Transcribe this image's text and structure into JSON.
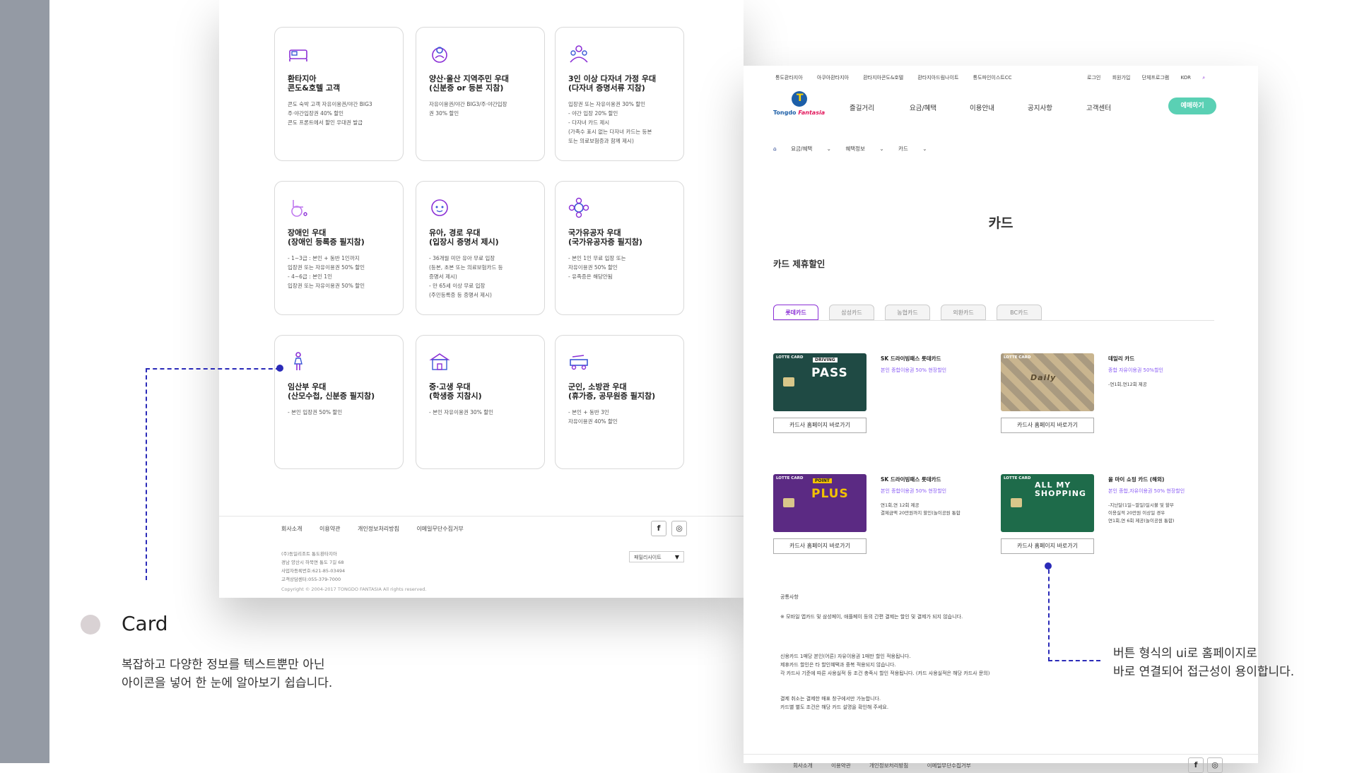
{
  "left_mock": {
    "cards": [
      {
        "title": "환타지아\n콘도&호텔 고객",
        "desc": "콘도 숙박 고객 자유이용권/야간 BIG3\n주·야간입장권 40% 할인\n콘도 프론트에서 할인 우대권 발급",
        "icon": "bed-icon"
      },
      {
        "title": "양산·울산 지역주민 우대\n(신분증 or 등본 지참)",
        "desc": "자유이용권/야간 BIG3/주·야간입장\n권 30% 할인",
        "icon": "map-pin-icon"
      },
      {
        "title": "3인 이상 다자녀 가정 우대\n(다자녀 증명서류 지참)",
        "desc": "입장권 또는 자유이용권 30% 할인\n- 야간 입장 20% 할인\n- 다자녀 카드 제시\n(가족수 표시 없는 다자녀 카드는 등본\n또는 의료보험증과 함께 제시)",
        "icon": "family-icon"
      },
      {
        "title": "장애인 우대\n(장애인 등록증 필지참)",
        "desc": "- 1~3급 : 본인 + 동반 1인까지\n입장권 또는 자유이용권 50% 할인\n- 4~6급 : 본인 1인\n입장권 또는 자유이용권 50% 할인",
        "icon": "wheelchair-icon"
      },
      {
        "title": "유아, 경로 우대\n(입장시 증명서 제시)",
        "desc": "- 36개월 미만 유아 무료 입장\n(등본, 초본 또는 의료보험카드 등\n증명서 제시)\n- 만 65세 이상 무료 입장\n(주민등록증 등 증명서 제시)",
        "icon": "baby-icon"
      },
      {
        "title": "국가유공자 우대\n(국가유공자증 필지참)",
        "desc": "- 본인 1인 무료 입장 또는\n자유이용권 50% 할인\n- 유족증은 해당안됨",
        "icon": "emblem-icon"
      },
      {
        "title": "임산부 우대\n(산모수첩, 신분증 필지참)",
        "desc": "- 본인 입장권 50% 할인",
        "icon": "pregnant-icon"
      },
      {
        "title": "중·고생 우대\n(학생증 지참시)",
        "desc": "- 본인 자유이용권 30% 할인",
        "icon": "school-icon"
      },
      {
        "title": "군인, 소방관 우대\n(휴가증, 공무원증 필지참)",
        "desc": "- 본인 + 동반 3인\n자유이용권 40% 할인",
        "icon": "firetruck-icon"
      }
    ],
    "footer_links": [
      "회사소개",
      "이용약관",
      "개인정보처리방침",
      "이메일무단수집거부"
    ],
    "address": "(주)동일리조트 통도환타지아\n경남 양산시 하북면 통도 7길 68\n사업자등록번호:621-85-03494\n고객상담센터:055-379-7000",
    "copyright": "Copyright © 2004-2017 TONGDO FANTASIA All rights reserved.",
    "family_site": "패밀리사이트"
  },
  "annotation_left": {
    "title": "Card",
    "desc": "복잡하고 다양한 정보를 텍스트뿐만 아닌\n아이콘을 넣어 한 눈에 알아보기 쉽습니다."
  },
  "right_mock": {
    "util_left": [
      "통도환타지아",
      "아쿠아환타지아",
      "환타지아콘도&호텔",
      "환타지아드림나이트",
      "통도파인이스트CC"
    ],
    "util_right": [
      "로그인",
      "회원가입",
      "단체프로그램",
      "KOR"
    ],
    "logo_text": "Tongdo",
    "logo_brand": "Fantasia",
    "gnb": [
      "즐길거리",
      "요금/혜택",
      "이용안내",
      "공지사항",
      "고객센터"
    ],
    "reserve_label": "예매하기",
    "breadcrumb": [
      "요금/혜택",
      "혜택정보",
      "카드"
    ],
    "page_title": "카드",
    "section_title": "카드 제휴할인",
    "tabs": [
      "롯데카드",
      "삼성카드",
      "농협카드",
      "외환카드",
      "BC카드"
    ],
    "cards": [
      {
        "name": "SK 드라이빙패스 롯데카드",
        "highlight": "본인 종합이용권 50% 현장할인",
        "desc": "",
        "art": "PASS",
        "tag": "DRIVING",
        "brand": "LOTTE CARD",
        "color": "#1f4a44"
      },
      {
        "name": "데일리 카드",
        "highlight": "종합 자유이용권 50%할인",
        "desc": "-연1회,연12회 제공",
        "art": "Daily",
        "tag": "",
        "brand": "LOTTE CARD",
        "color": "#c9b58f"
      },
      {
        "name": "SK 드라이빙패스 롯데카드",
        "highlight": "본인 종합이용권 50% 현장할인",
        "desc": "연1회,연 12회 제공\n결제금액 20만원까지 할인(놀이공원 통합",
        "art": "PLUS",
        "tag": "POINT",
        "brand": "LOTTE CARD",
        "color": "#5b2a83"
      },
      {
        "name": "올 마이 쇼핑 카드 (해외)",
        "highlight": "본인 종합,자유이용권 50% 현장할인",
        "desc": "-지난달(1일~말일)일시불 및 할부\n이용실적 20만원 이상일 경우\n연1회,연 6회 제공(놀이공원 통합)",
        "art": "ALL MY\nSHOPPING",
        "tag": "",
        "brand": "LOTTE CARD",
        "color": "#1e6b4a"
      }
    ],
    "card_button_label": "카드사 홈페이지 바로가기",
    "notice_title": "공통사항",
    "notice_1": "※ 모바일 앱카드 및 삼성페이, 애플페이 등의 간편 결제는 할인 및 결제가 되지 않습니다.",
    "notice_2": "신용카드 1매당 본인(어른) 자유이용권 1매만 할인 적용됩니다.\n제휴카드 할인은 타 할인혜택과 중복 적용되지 않습니다.\n각 카드사 기준에 따른 사용실적 등 조건 충족시 할인 적용됩니다. (카드 사용실적은 해당 카드사 문의)",
    "notice_3": "결제 취소는 결제한 매표 창구에서만 가능합니다.\n카드별 별도 조건은 해당 카드 설명을 확인해 주세요.",
    "footer_links": [
      "회사소개",
      "이용약관",
      "개인정보처리방침",
      "이메일무단수집거부"
    ]
  },
  "annotation_right": {
    "desc": "버튼 형식의 ui로 홈페이지로\n바로 연결되어 접근성이 용이합니다."
  },
  "colors": {
    "accent": "#8b2fd6",
    "annotation": "#2a2ab8",
    "reserve": "#5ad0b4"
  }
}
